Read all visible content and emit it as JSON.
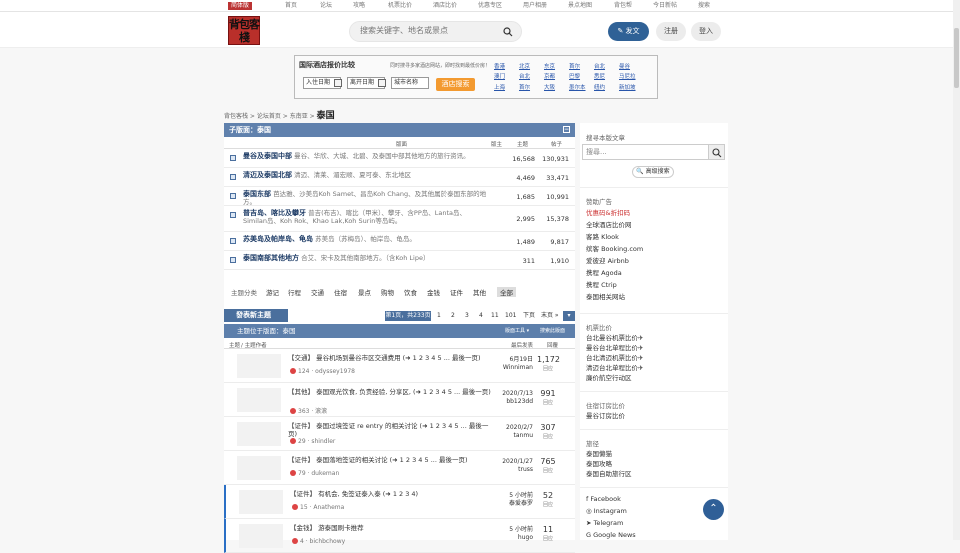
{
  "topnav": {
    "badge": "简体版",
    "links": [
      "首页",
      "论坛",
      "攻略",
      "机票比价",
      "酒店比价",
      "优惠专区",
      "用户相册",
      "景点地图",
      "背包帮",
      "今日新帖",
      "搜索"
    ]
  },
  "header": {
    "logo_text": "背包客棧",
    "search_placeholder": "搜索关键字、地名或景点",
    "post_label": "发文",
    "register_label": "注册",
    "login_label": "登入"
  },
  "hotel_box": {
    "title": "国际酒店报价比较",
    "subtitle": "同时搜寻多家酒店网站，即时找到最低价房！",
    "checkin": "入住日期",
    "checkout": "离开日期",
    "city": "城市名称",
    "button": "酒店搜索",
    "cities": [
      "香港",
      "北京",
      "东京",
      "首尔",
      "台北",
      "曼谷",
      "澳门",
      "台北",
      "京都",
      "巴黎",
      "悉尼",
      "马尼拉",
      "上海",
      "首尔",
      "大阪",
      "墨尔本",
      "纽约",
      "新加坡"
    ]
  },
  "breadcrumb": {
    "items": [
      "背包客栈",
      "论坛首页",
      "东南亚"
    ],
    "current": "泰国"
  },
  "subforum": {
    "header": "子版面：泰国",
    "cols": [
      "版面",
      "版主",
      "主题",
      "帖子"
    ],
    "rows": [
      {
        "name": "曼谷及泰国中部",
        "desc": "曼谷、华欣、大城、北碧、及泰国中部其他地方的旅行资讯。",
        "topics": "16,568",
        "posts": "130,931"
      },
      {
        "name": "清迈及泰国北部",
        "desc": "清迈、清莱、湄宏顺、夏可泰、东北地区",
        "topics": "4,469",
        "posts": "33,471"
      },
      {
        "name": "泰国东部",
        "desc": "芭达雅、沙美岛Koh Samet、昌岛Koh Chang、及其他属於泰国东部的地方。",
        "topics": "1,685",
        "posts": "10,991"
      },
      {
        "name": "普吉岛、喀比及攀牙",
        "desc": "普吉(布吉)、喀比（甲米）、攀牙、含PP岛、Lanta岛、Similan岛、Koh Rok、Khao Lak,Koh Surin等岛屿。",
        "topics": "2,995",
        "posts": "15,378"
      },
      {
        "name": "苏美岛及帕岸岛、龟岛",
        "desc": "苏美岛（苏梅岛）、帕岸岛、龟岛。",
        "topics": "1,489",
        "posts": "9,817"
      },
      {
        "name": "泰国南部其他地方",
        "desc": "合艾、宋卡及其他南部地方。（含Koh Lipe）",
        "topics": "311",
        "posts": "1,910"
      }
    ]
  },
  "filters": {
    "label": "主题分类",
    "items": [
      "游记",
      "行程",
      "交通",
      "住宿",
      "景点",
      "购物",
      "饮食",
      "金钱",
      "证件",
      "其他",
      "全部"
    ]
  },
  "new_topic": "發表新主題",
  "pager": {
    "info": "第1页，共233页",
    "pages": [
      "1",
      "2",
      "3",
      "4",
      "11",
      "101"
    ],
    "next": "下页",
    "last": "末页 »"
  },
  "topics": {
    "header": "主题位于版面：泰国",
    "tools": "版面工具 ▾",
    "search": "搜索此版面",
    "cols": [
      "主题",
      "/ 主题作者",
      "最后发表",
      "回覆"
    ],
    "rows": [
      {
        "title": "【交通】 曼谷机场到曼谷市区交通费用 (➜ 1 2 3 4 5 ... 最後一页)",
        "meta": "124 · odyssey1978",
        "last_date": "6月19日",
        "last_user": "Winniman",
        "replies": "1,172",
        "reply_label": "回应"
      },
      {
        "title": "【其他】 泰国观光饮食, 负责经验, 分享区, (➜ 1 2 3 4 5 ... 最後一页)",
        "meta": "363 · 滚滚",
        "last_date": "2020/7/13",
        "last_user": "bb123dd",
        "replies": "991",
        "reply_label": "回应"
      },
      {
        "title": "【证件】 泰国过境签证 re entry 的相关讨论 (➜ 1 2 3 4 5 ... 最後一页)",
        "meta": "29 · shindler",
        "last_date": "2020/2/7",
        "last_user": "tanmu",
        "replies": "307",
        "reply_label": "回应"
      },
      {
        "title": "【证件】 泰国落地签证的相关讨论 (➜ 1 2 3 4 5 ... 最後一页)",
        "meta": "79 · dukeman",
        "last_date": "2020/1/27",
        "last_user": "truss",
        "replies": "765",
        "reply_label": "回应"
      },
      {
        "title": "【证件】 有机会, 免签证泰入泰 (➜ 1 2 3 4)",
        "meta": "15 · Anathema",
        "last_date": "5 小时前",
        "last_user": "泰爱泰罗",
        "replies": "52",
        "reply_label": "回应"
      },
      {
        "title": "【金钱】 游泰国刷卡推荐",
        "meta": "4 · bichbchowy",
        "last_date": "5 小时前",
        "last_user": "hugo",
        "replies": "11",
        "reply_label": "回应"
      }
    ]
  },
  "sidebar": {
    "search_title": "搜寻本版文章",
    "search_placeholder": "搜尋...",
    "advanced": "🔍 高级搜索",
    "ads_title": "赞助广告",
    "ads": [
      "优惠码&折扣码",
      "全球酒店比价网",
      "客路 Klook",
      "缤客 Booking.com",
      "爱彼迎 Airbnb",
      "携程 Agoda",
      "携程 Ctrip",
      "泰国相关网站"
    ],
    "flight_title": "机票比价",
    "flights": [
      "台北曼谷机票比价✈",
      "曼谷台北单程比价✈",
      "台北清迈机票比价✈",
      "清迈台北单程比价✈",
      "廉价航空行动区"
    ],
    "hotel_title": "住宿订房比价",
    "hotels": [
      "曼谷订房比价"
    ],
    "guide_title": "旅径",
    "guides": [
      "泰国懒猫",
      "泰国攻略",
      "泰国自助旅行区"
    ],
    "social": [
      "Facebook",
      "Instagram",
      "Telegram",
      "Google News"
    ]
  }
}
